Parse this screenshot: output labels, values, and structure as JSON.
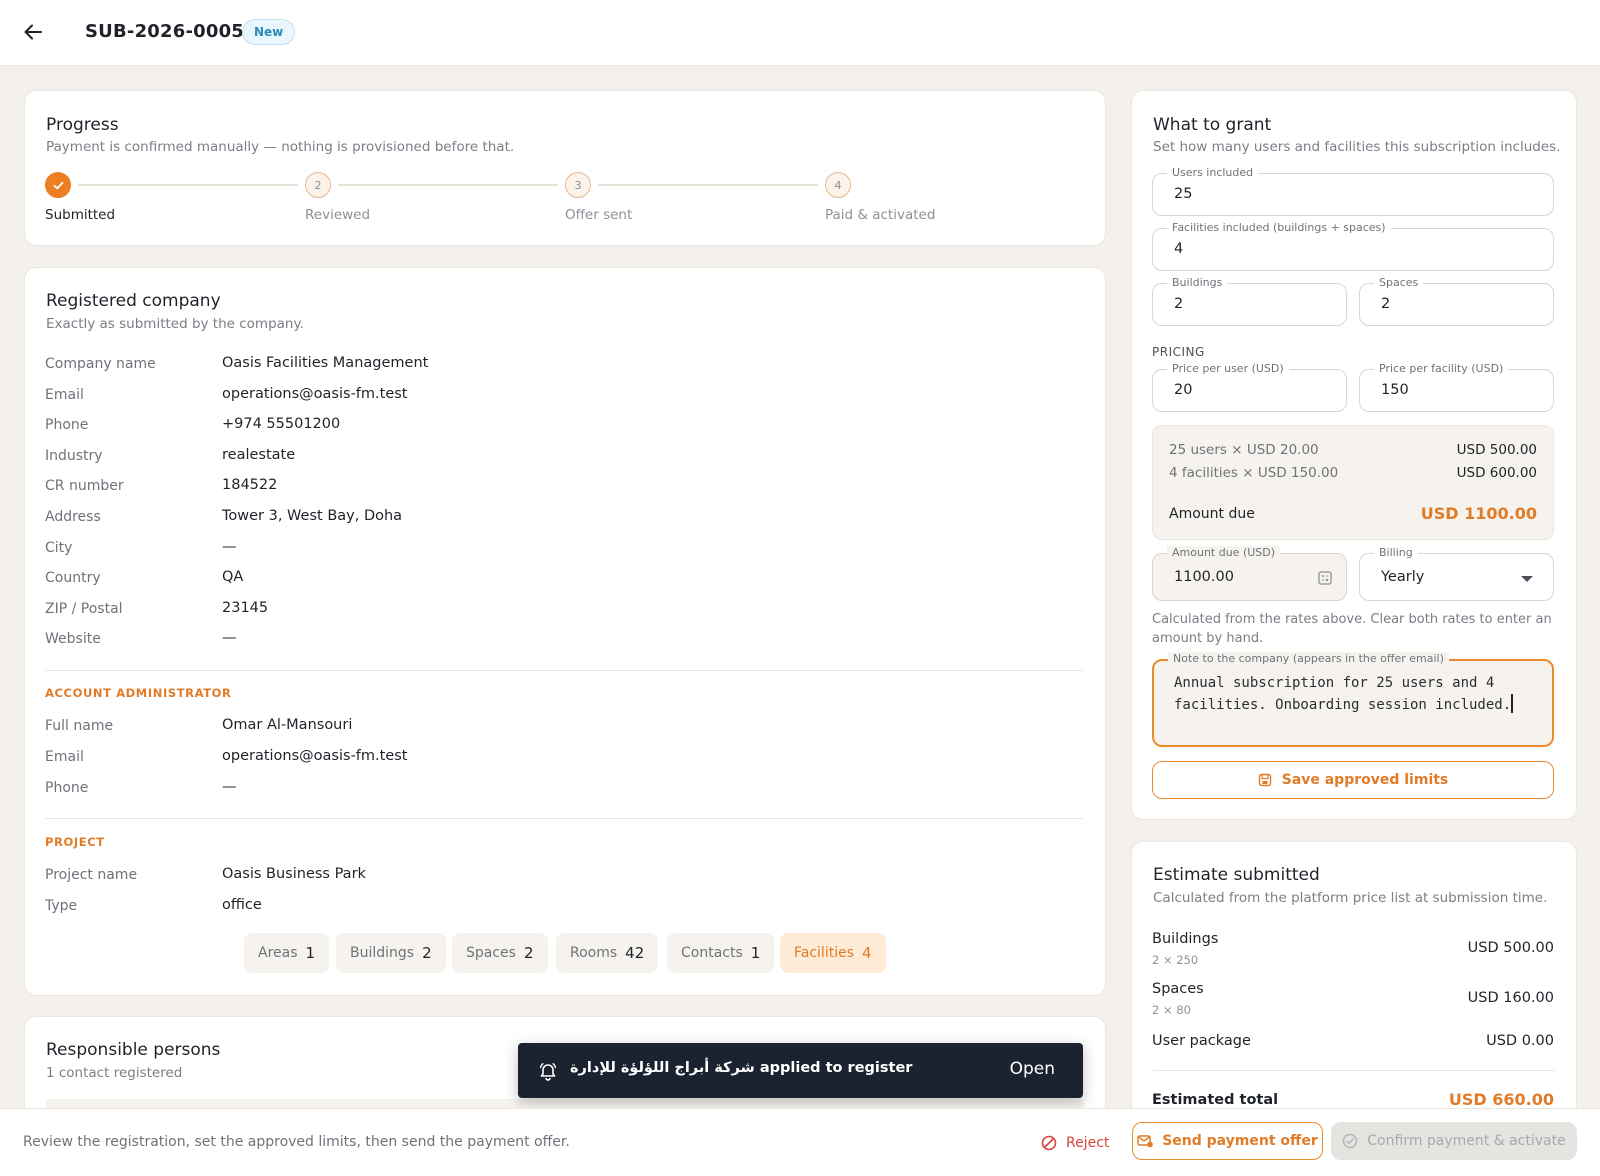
{
  "header": {
    "title": "SUB-2026-0005",
    "badge": "New"
  },
  "progress": {
    "title": "Progress",
    "subtitle": "Payment is confirmed manually — nothing is provisioned before that.",
    "steps": [
      {
        "label": "Submitted",
        "marker": "✓",
        "state": "done"
      },
      {
        "label": "Reviewed",
        "marker": "2",
        "state": "pending"
      },
      {
        "label": "Offer sent",
        "marker": "3",
        "state": "pending"
      },
      {
        "label": "Paid & activated",
        "marker": "4",
        "state": "pending"
      }
    ]
  },
  "company": {
    "title": "Registered company",
    "subtitle": "Exactly as submitted by the company.",
    "fields": [
      {
        "label": "Company name",
        "value": "Oasis Facilities Management"
      },
      {
        "label": "Email",
        "value": "operations@oasis-fm.test"
      },
      {
        "label": "Phone",
        "value": "+974 55501200"
      },
      {
        "label": "Industry",
        "value": "realestate"
      },
      {
        "label": "CR number",
        "value": "184522"
      },
      {
        "label": "Address",
        "value": "Tower 3, West Bay, Doha"
      },
      {
        "label": "City",
        "value": "—"
      },
      {
        "label": "Country",
        "value": "QA"
      },
      {
        "label": "ZIP / Postal",
        "value": "23145"
      },
      {
        "label": "Website",
        "value": "—"
      }
    ],
    "admin_title": "ACCOUNT ADMINISTRATOR",
    "admin": [
      {
        "label": "Full name",
        "value": "Omar Al-Mansouri"
      },
      {
        "label": "Email",
        "value": "operations@oasis-fm.test"
      },
      {
        "label": "Phone",
        "value": "—"
      }
    ],
    "project_title": "PROJECT",
    "project": [
      {
        "label": "Project name",
        "value": "Oasis Business Park"
      },
      {
        "label": "Type",
        "value": "office"
      }
    ],
    "chips": [
      {
        "label": "Areas",
        "count": "1"
      },
      {
        "label": "Buildings",
        "count": "2"
      },
      {
        "label": "Spaces",
        "count": "2"
      },
      {
        "label": "Rooms",
        "count": "42"
      },
      {
        "label": "Contacts",
        "count": "1"
      },
      {
        "label": "Facilities",
        "count": "4"
      }
    ]
  },
  "responsible": {
    "title": "Responsible persons",
    "subtitle": "1 contact registered"
  },
  "grant": {
    "title": "What to grant",
    "subtitle": "Set how many users and facilities this subscription includes.",
    "users_label": "Users included",
    "users_value": "25",
    "facilities_label": "Facilities included (buildings + spaces)",
    "facilities_value": "4",
    "buildings_label": "Buildings",
    "buildings_value": "2",
    "spaces_label": "Spaces",
    "spaces_value": "2",
    "pricing_label": "PRICING",
    "price_user_label": "Price per user (USD)",
    "price_user_value": "20",
    "price_facility_label": "Price per facility (USD)",
    "price_facility_value": "150",
    "summary": {
      "line1_left": "25 users × USD 20.00",
      "line1_right": "USD 500.00",
      "line2_left": "4 facilities × USD 150.00",
      "line2_right": "USD 600.00",
      "total_label": "Amount due",
      "total_value": "USD 1100.00"
    },
    "amount_label": "Amount due (USD)",
    "amount_value": "1100.00",
    "billing_label": "Billing",
    "billing_value": "Yearly",
    "help": "Calculated from the rates above. Clear both rates to enter an amount by hand.",
    "note_label": "Note to the company (appears in the offer email)",
    "note_value": "Annual subscription for 25 users and 4 facilities. Onboarding session included.",
    "save_label": "Save approved limits"
  },
  "estimate": {
    "title": "Estimate submitted",
    "subtitle": "Calculated from the platform price list at submission time.",
    "rows": [
      {
        "label": "Buildings",
        "detail": "2 × 250",
        "value": "USD 500.00"
      },
      {
        "label": "Spaces",
        "detail": "2 × 80",
        "value": "USD 160.00"
      },
      {
        "label": "User package",
        "detail": "",
        "value": "USD 0.00"
      }
    ],
    "total_label": "Estimated total",
    "total_value": "USD 660.00"
  },
  "footer": {
    "hint": "Review the registration, set the approved limits, then send the payment offer.",
    "reject_label": "Reject",
    "send_label": "Send payment offer",
    "confirm_label": "Confirm payment & activate"
  },
  "toast": {
    "message": "شركة أبراج اللؤلؤة للإدارة applied to register",
    "action": "Open"
  },
  "colors": {
    "accent": "#ec7f22",
    "danger": "#d9443a",
    "toast_bg": "#1b2330"
  },
  "icons": [
    "back-arrow-icon",
    "check-icon",
    "calculator-icon",
    "chevron-down-icon",
    "save-icon",
    "bell-icon",
    "ban-icon",
    "send-mail-icon",
    "check-circle-icon"
  ]
}
